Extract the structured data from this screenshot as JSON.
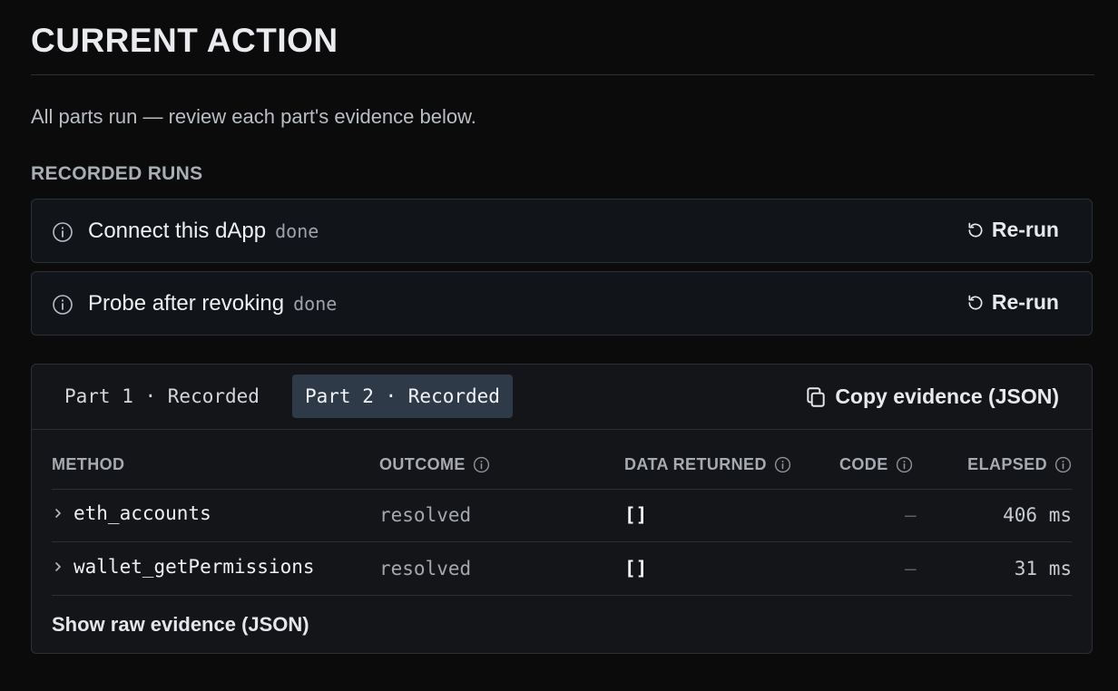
{
  "header": {
    "title": "CURRENT ACTION",
    "status_message": "All parts run — review each part's evidence below."
  },
  "recorded_runs": {
    "label": "RECORDED RUNS",
    "items": [
      {
        "name": "Connect this dApp",
        "state": "done",
        "action_label": "Re-run"
      },
      {
        "name": "Probe after revoking",
        "state": "done",
        "action_label": "Re-run"
      }
    ]
  },
  "evidence": {
    "tabs": [
      {
        "label": "Part 1 · Recorded",
        "active": false
      },
      {
        "label": "Part 2 · Recorded",
        "active": true
      }
    ],
    "copy_label": "Copy evidence (JSON)",
    "columns": [
      "METHOD",
      "OUTCOME",
      "DATA RETURNED",
      "CODE",
      "ELAPSED"
    ],
    "rows": [
      {
        "method": "eth_accounts",
        "outcome": "resolved",
        "data": "[]",
        "code": "—",
        "elapsed": "406 ms"
      },
      {
        "method": "wallet_getPermissions",
        "outcome": "resolved",
        "data": "[]",
        "code": "—",
        "elapsed": "31 ms"
      }
    ],
    "raw_link": "Show raw evidence (JSON)"
  },
  "icons": {
    "info": "info-icon",
    "rerun": "rerun-icon",
    "copy": "copy-icon",
    "expand": "chevron-right-icon"
  }
}
